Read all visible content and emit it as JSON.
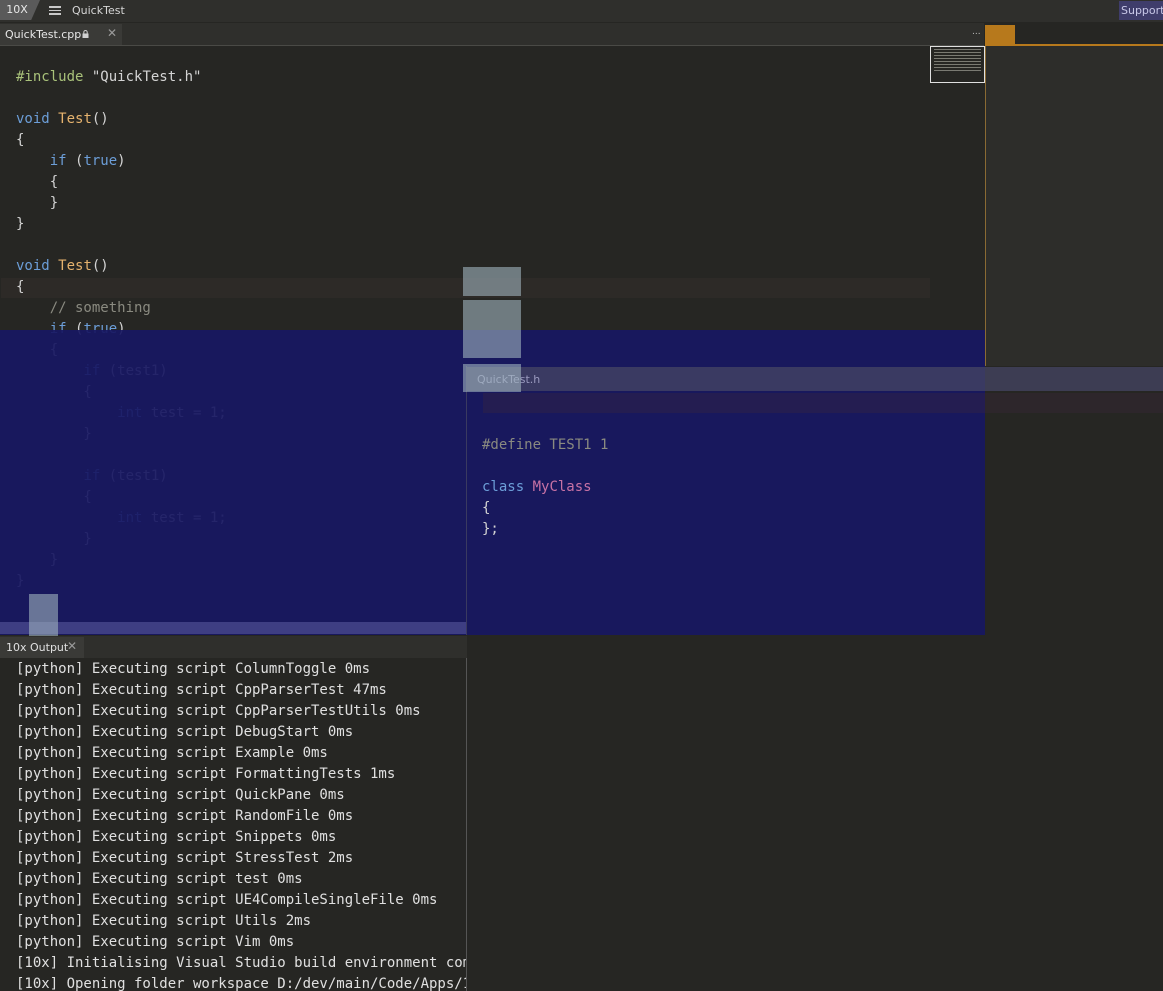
{
  "app": {
    "logo": "10X",
    "workspace": "QuickTest",
    "support_label": "Support"
  },
  "tabs": {
    "cpp": {
      "label": "QuickTest.cpp",
      "close": "✕"
    },
    "more": "..."
  },
  "editor_cpp": {
    "lines": [
      "",
      "#include \"QuickTest.h\"",
      "",
      "void Test()",
      "{",
      "    if (true)",
      "    {",
      "    }",
      "}",
      "",
      "void Test()",
      "{",
      "    // something",
      "    if (true)",
      "    {",
      "        if (test1)",
      "        {",
      "            int test = 1;",
      "        }",
      "",
      "        if (test1)",
      "        {",
      "            int test = 1;",
      "        }",
      "    }",
      "}"
    ]
  },
  "editor_h": {
    "title": "QuickTest.h",
    "lines": [
      "",
      "#define TEST1 1",
      "",
      "class MyClass",
      "{",
      "};"
    ]
  },
  "output": {
    "tab_label": "10x Output",
    "close": "✕",
    "lines": [
      "[python] Executing script ColumnToggle 0ms",
      "[python] Executing script CppParserTest 47ms",
      "[python] Executing script CppParserTestUtils 0ms",
      "[python] Executing script DebugStart 0ms",
      "[python] Executing script Example 0ms",
      "[python] Executing script FormattingTests 1ms",
      "[python] Executing script QuickPane 0ms",
      "[python] Executing script RandomFile 0ms",
      "[python] Executing script Snippets 0ms",
      "[python] Executing script StressTest 2ms",
      "[python] Executing script test 0ms",
      "[python] Executing script UE4CompileSingleFile 0ms",
      "[python] Executing script Utils 2ms",
      "[python] Executing script Vim 0ms",
      "[10x] Initialising Visual Studio build environment com",
      "[10x] Opening folder workspace D:/dev/main/Code/Apps/1"
    ]
  },
  "colors": {
    "accent": "#b7791c",
    "overlay": "#18186a",
    "keyword": "#6c9ed8",
    "function": "#e6b36e",
    "class": "#c872a5"
  }
}
